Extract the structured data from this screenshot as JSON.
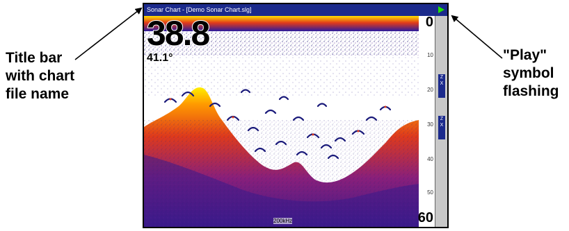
{
  "callouts": {
    "left": [
      "Title bar",
      "with chart",
      "file name"
    ],
    "right": [
      "\"Play\"",
      "symbol",
      "flashing"
    ]
  },
  "window": {
    "title": "Sonar Chart - [Demo Sonar Chart.slg]",
    "play_icon": "play-triangle-icon",
    "play_color": "#22e000",
    "titlebar_color": "#1b2a8c"
  },
  "sonar": {
    "depth": "38.8",
    "temperature": "41.1°",
    "frequency": "200kHz",
    "scale_top": "0",
    "scale_bottom": "60",
    "scale_ticks": [
      "10",
      "20",
      "30",
      "40",
      "50"
    ]
  },
  "sidebar": {
    "zoom_in": "Z\nX",
    "zoom_out": "Z\nX"
  }
}
